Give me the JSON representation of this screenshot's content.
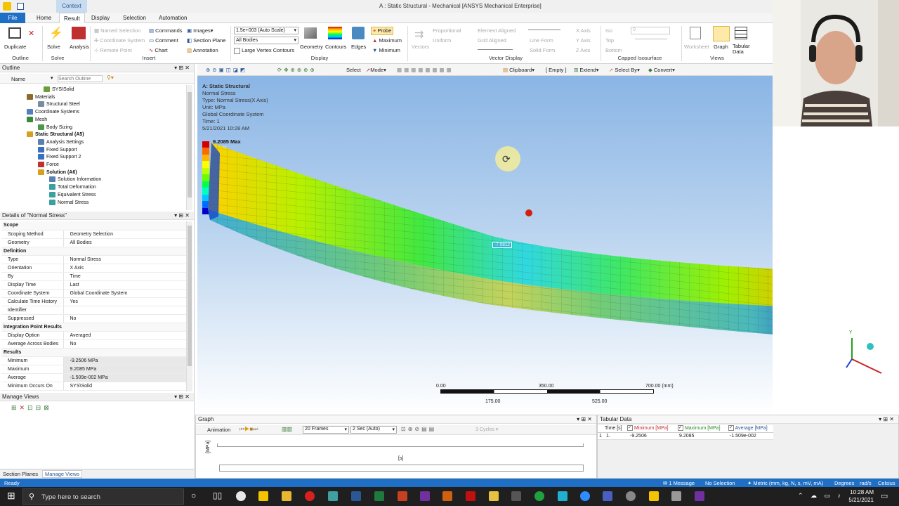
{
  "window": {
    "title": "A : Static Structural - Mechanical [ANSYS Mechanical Enterprise]",
    "context_tab": "Context"
  },
  "ribbon_tabs": [
    "File",
    "Home",
    "Result",
    "Display",
    "Selection",
    "Automation"
  ],
  "ribbon": {
    "outline": {
      "duplicate": "Duplicate",
      "group": "Outline"
    },
    "solve": {
      "solve": "Solve",
      "analysis": "Analysis",
      "group": "Solve"
    },
    "insert": {
      "named_selection": "Named Selection",
      "coordinate_system": "Coordinate System",
      "remote_point": "Remote Point",
      "commands": "Commands",
      "comment": "Comment",
      "chart": "Chart",
      "images": "Images",
      "section_plane": "Section Plane",
      "annotation": "Annotation",
      "group": "Insert"
    },
    "display": {
      "scale": "1.5e+003 (Auto Scale)",
      "bodies": "All Bodies",
      "large_vertex": "Large Vertex Contours",
      "geometry": "Geometry",
      "contours": "Contours",
      "edges": "Edges",
      "probe": "Probe",
      "maximum": "Maximum",
      "minimum": "Minimum",
      "group": "Display"
    },
    "vector": {
      "vectors": "Vectors",
      "proportional": "Proportional",
      "uniform": "Uniform",
      "element_aligned": "Element Aligned",
      "grid_aligned": "Grid Aligned",
      "line_form": "Line Form",
      "solid_form": "Solid Form",
      "x_axis": "X Axis",
      "y_axis": "Y Axis",
      "z_axis": "Z Axis",
      "group": "Vector Display"
    },
    "capped": {
      "iso": "Iso",
      "top": "Top",
      "bottom": "Bottom",
      "value": "0",
      "group": "Capped Isosurface"
    },
    "views": {
      "worksheet": "Worksheet",
      "graph": "Graph",
      "tabular_data": "Tabular Data",
      "group": "Views"
    }
  },
  "outline": {
    "title": "Outline",
    "name_col": "Name",
    "search_placeholder": "Search Outline",
    "items": [
      {
        "label": "SYS\\Solid",
        "color": "#6a9f3a"
      },
      {
        "label": "Materials",
        "color": "#8c6a2a"
      },
      {
        "label": "Structural Steel",
        "color": "#7a8aa0"
      },
      {
        "label": "Coordinate Systems",
        "color": "#5080c0"
      },
      {
        "label": "Mesh",
        "color": "#3b8a3b"
      },
      {
        "label": "Body Sizing",
        "color": "#4a9a4a"
      },
      {
        "label": "Static Structural (A5)",
        "color": "#d4a020"
      },
      {
        "label": "Analysis Settings",
        "color": "#5a7fb0"
      },
      {
        "label": "Fixed Support",
        "color": "#3b6fc0"
      },
      {
        "label": "Fixed Support 2",
        "color": "#3b6fc0"
      },
      {
        "label": "Force",
        "color": "#c03030"
      },
      {
        "label": "Solution (A6)",
        "color": "#d4a020"
      },
      {
        "label": "Solution Information",
        "color": "#5a7fb0"
      },
      {
        "label": "Total Deformation",
        "color": "#3aa0a0"
      },
      {
        "label": "Equivalent Stress",
        "color": "#3aa0a0"
      },
      {
        "label": "Normal Stress",
        "color": "#3aa0a0"
      }
    ]
  },
  "details": {
    "title": "Details of \"Normal Stress\"",
    "rows": [
      {
        "section": "Scope"
      },
      {
        "k": "Scoping Method",
        "v": "Geometry Selection"
      },
      {
        "k": "Geometry",
        "v": "All Bodies"
      },
      {
        "section": "Definition"
      },
      {
        "k": "Type",
        "v": "Normal Stress"
      },
      {
        "k": "Orientation",
        "v": "X Axis"
      },
      {
        "k": "By",
        "v": "Time"
      },
      {
        "k": "Display Time",
        "v": "Last"
      },
      {
        "k": "Coordinate System",
        "v": "Global Coordinate System"
      },
      {
        "k": "Calculate Time History",
        "v": "Yes"
      },
      {
        "k": "Identifier",
        "v": ""
      },
      {
        "k": "Suppressed",
        "v": "No"
      },
      {
        "section": "Integration Point Results"
      },
      {
        "k": "Display Option",
        "v": "Averaged"
      },
      {
        "k": "Average Across Bodies",
        "v": "No"
      },
      {
        "section": "Results"
      },
      {
        "k": "Minimum",
        "v": "-9.2506 MPa",
        "hl": true
      },
      {
        "k": "Maximum",
        "v": "9.2085 MPa",
        "hl": true
      },
      {
        "k": "Average",
        "v": "-1.509e-002 MPa",
        "hl": true
      },
      {
        "k": "Minimum Occurs On",
        "v": "SYS\\Solid"
      }
    ]
  },
  "manage_views": {
    "title": "Manage Views",
    "tab_section_planes": "Section Planes",
    "tab_manage_views": "Manage Views"
  },
  "viewport_toolbar": {
    "select": "Select",
    "mode": "Mode",
    "clipboard": "Clipboard",
    "empty": "[ Empty ]",
    "extend": "Extend",
    "select_by": "Select By",
    "convert": "Convert"
  },
  "result_info": {
    "line1": "A: Static Structural",
    "line2": "Normal Stress",
    "line3": "Type: Normal Stress(X Axis)",
    "line4": "Unit: MPa",
    "line5": "Global Coordinate System",
    "line6": "Time: 1",
    "line7": "5/21/2021 10:28 AM"
  },
  "legend": {
    "max_label": "9.2085 Max",
    "colors": [
      "#d40000",
      "#ff6a00",
      "#ffb400",
      "#ffff00",
      "#c0ff00",
      "#6aff00",
      "#00ff50",
      "#00ffc0",
      "#00c8ff",
      "#006aff",
      "#0000c8"
    ],
    "values": [
      "7.1575",
      "5.1065",
      "3.0555",
      "1.0045",
      "-1.0465",
      "-3.0976",
      "-5.1486",
      "-7.1996",
      "-9.2506 Min"
    ]
  },
  "probe_label": "-7.0812",
  "scale_bar": {
    "v0": "0.00",
    "v1": "350.00",
    "v2": "700.00 (mm)",
    "v3": "175.00",
    "v4": "525.00"
  },
  "graph": {
    "title": "Graph",
    "animation": "Animation",
    "frames": "20 Frames",
    "duration": "2 Sec (Auto)",
    "cycles": "3 Cycles",
    "y_unit": "[MPa]",
    "x_unit": "[s]"
  },
  "tabular": {
    "title": "Tabular Data",
    "headers": [
      "Time [s]",
      "Minimum [MPa]",
      "Maximum [MPa]",
      "Average [MPa]"
    ],
    "row": [
      "1",
      "1.",
      "-9.2506",
      "9.2085",
      "-1.509e-002"
    ]
  },
  "status": {
    "ready": "Ready",
    "message": "1 Message",
    "selection": "No Selection",
    "units": "Metric (mm, kg, N, s, mV, mA)",
    "degrees": "Degrees",
    "rads": "rad/s",
    "celsius": "Celsius"
  },
  "taskbar": {
    "search_placeholder": "Type here to search",
    "time": "10:28 AM",
    "date": "5/21/2021"
  }
}
